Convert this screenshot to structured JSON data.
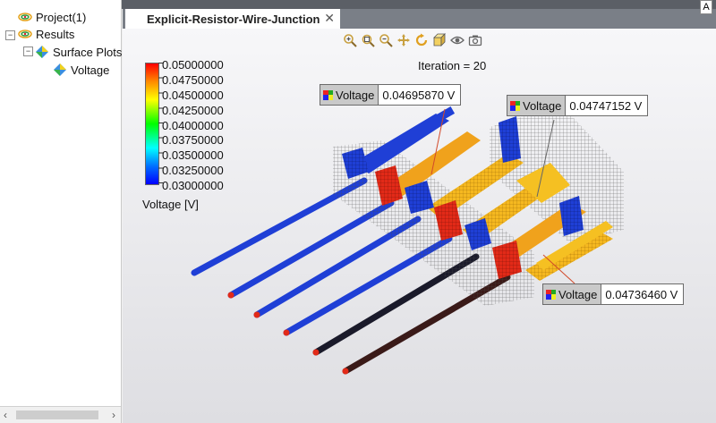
{
  "tree": {
    "items": [
      {
        "label": "Project(1)",
        "icon": "project-icon"
      },
      {
        "label": "Results",
        "icon": "results-icon"
      },
      {
        "label": "Surface Plots",
        "icon": "surface-plots-icon"
      },
      {
        "label": "Voltage",
        "icon": "voltage-plot-icon"
      }
    ],
    "expand_symbol": "−"
  },
  "scrollbar": {
    "left_arrow": "‹",
    "right_arrow": "›"
  },
  "tab": {
    "title": "Explicit-Resistor-Wire-Junction",
    "close": "✕",
    "corner_label": "A"
  },
  "toolbar": {
    "icons": [
      "zoom-in-icon",
      "zoom-fit-icon",
      "zoom-out-icon",
      "pan-icon",
      "rotate-icon",
      "view-cube-icon",
      "visibility-icon",
      "camera-icon"
    ]
  },
  "iteration": "Iteration = 20",
  "legend": {
    "title": "Voltage [V]",
    "labels": [
      "0.05000000",
      "0.04750000",
      "0.04500000",
      "0.04250000",
      "0.04000000",
      "0.03750000",
      "0.03500000",
      "0.03250000",
      "0.03000000"
    ],
    "max_color": "#ff0000",
    "min_color": "#0000ff"
  },
  "probes": [
    {
      "label": "Voltage",
      "value": "0.04695870 V"
    },
    {
      "label": "Voltage",
      "value": "0.04747152 V"
    },
    {
      "label": "Voltage",
      "value": "0.04736460 V"
    }
  ],
  "colors": {
    "wire_blue": "#1f3fd6",
    "wire_dark": "#1a1a2a",
    "resistor_red": "#e22a18",
    "strap_orange": "#f0a21c",
    "strap_yellow": "#f5c022",
    "mesh_gray": "#555555"
  }
}
